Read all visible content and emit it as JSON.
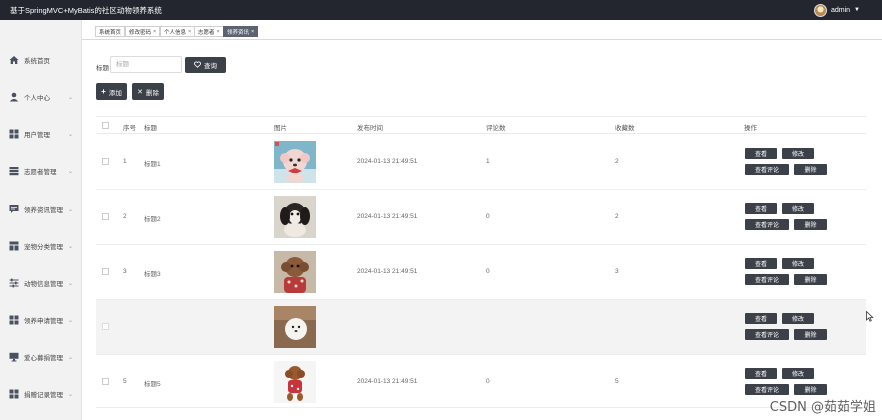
{
  "app_title": "基于SpringMVC+MyBatis的社区动物领养系统",
  "user": {
    "name": "admin",
    "caret": "▼"
  },
  "sidebar": {
    "items": [
      {
        "label": "系统首页",
        "icon": "home-icon",
        "chevron": ""
      },
      {
        "label": "个人中心",
        "icon": "user-icon",
        "chevron": "⌄"
      },
      {
        "label": "用户管理",
        "icon": "grid-icon",
        "chevron": "⌄"
      },
      {
        "label": "志愿者管理",
        "icon": "layers-icon",
        "chevron": "⌄"
      },
      {
        "label": "领养资讯管理",
        "icon": "message-icon",
        "chevron": "⌄"
      },
      {
        "label": "宠物分类管理",
        "icon": "list-icon",
        "chevron": "⌄"
      },
      {
        "label": "动物信息管理",
        "icon": "sliders-icon",
        "chevron": "⌄"
      },
      {
        "label": "领养申请管理",
        "icon": "grid-icon",
        "chevron": "⌄"
      },
      {
        "label": "爱心募捐管理",
        "icon": "monitor-icon",
        "chevron": "⌄"
      },
      {
        "label": "捐赠记录管理",
        "icon": "grid-icon",
        "chevron": "⌄"
      }
    ]
  },
  "tabs": [
    {
      "label": "系统首页",
      "close": ""
    },
    {
      "label": "修改密码",
      "close": "×"
    },
    {
      "label": "个人信息",
      "close": "×"
    },
    {
      "label": "志愿者",
      "close": "×"
    },
    {
      "label": "领养资讯",
      "close": "×"
    }
  ],
  "search": {
    "label": "标题",
    "placeholder": "标题",
    "button": "查询"
  },
  "toolbar": {
    "add": "添加",
    "delete": "删除"
  },
  "table": {
    "headers": [
      "序号",
      "标题",
      "图片",
      "发布时间",
      "评论数",
      "收藏数",
      "操作"
    ],
    "rows": [
      {
        "index": "1",
        "title": "标题1",
        "time": "2024-01-13 21:49:51",
        "comments": "1",
        "favorites": "2"
      },
      {
        "index": "2",
        "title": "标题2",
        "time": "2024-01-13 21:49:51",
        "comments": "0",
        "favorites": "2"
      },
      {
        "index": "3",
        "title": "标题3",
        "time": "2024-01-13 21:49:51",
        "comments": "0",
        "favorites": "3"
      },
      {
        "index": "",
        "title": "",
        "time": "",
        "comments": "",
        "favorites": ""
      },
      {
        "index": "5",
        "title": "标题5",
        "time": "2024-01-13 21:49:51",
        "comments": "0",
        "favorites": "5"
      }
    ],
    "actions": {
      "view": "查看",
      "edit": "修改",
      "view_comments": "查看评论",
      "delete": "删除"
    }
  },
  "watermark": "CSDN @茹茹学姐",
  "colors": {
    "topbar": "#23262e",
    "button": "#3b4049",
    "active_tab": "#5c6370"
  }
}
